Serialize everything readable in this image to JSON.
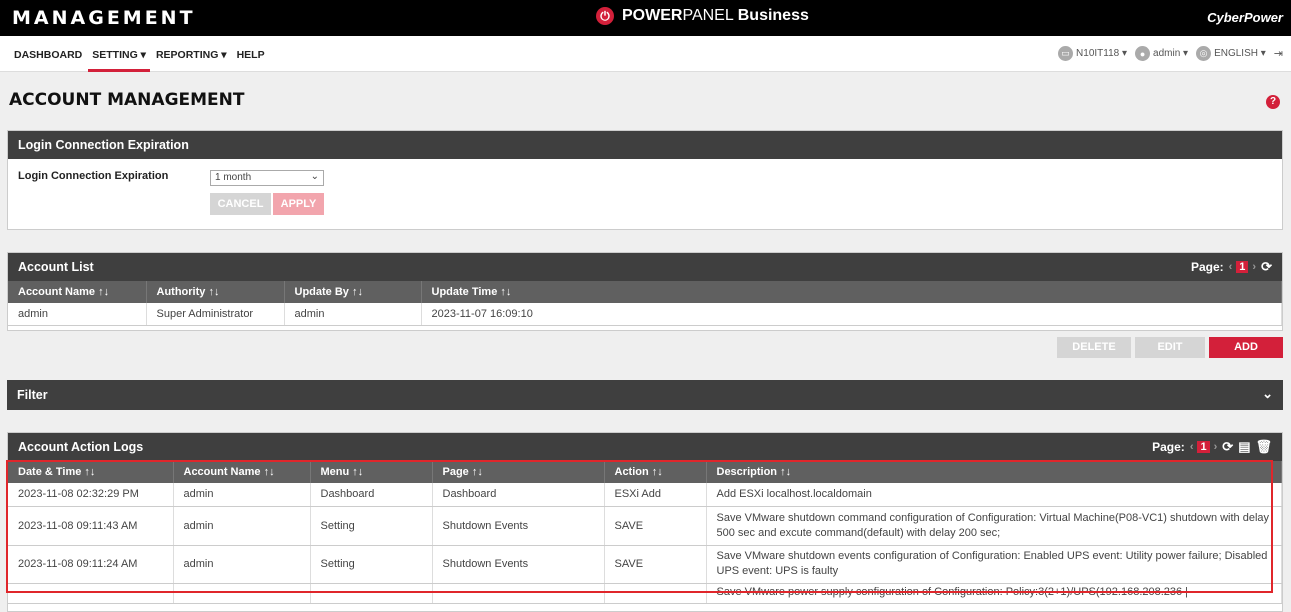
{
  "topbar": {
    "title": "MANAGEMENT",
    "brand_bold": "POWER",
    "brand_light": "PANEL",
    "brand_suffix": "Business",
    "vendor": "CyberPower"
  },
  "nav": {
    "items": [
      {
        "label": "DASHBOARD"
      },
      {
        "label": "SETTING ▾"
      },
      {
        "label": "REPORTING ▾"
      },
      {
        "label": "HELP"
      }
    ],
    "host": "N10IT118 ▾",
    "user": "admin ▾",
    "language": "ENGLISH ▾",
    "logout_icon": "logout-icon"
  },
  "page_title": "ACCOUNT MANAGEMENT",
  "login_panel": {
    "header": "Login Connection Expiration",
    "label": "Login Connection Expiration",
    "selected": "1 month",
    "cancel": "CANCEL",
    "apply": "APPLY"
  },
  "account_list": {
    "header": "Account List",
    "page_label": "Page:",
    "page_num": "1",
    "columns": [
      "Account Name ↑↓",
      "Authority ↑↓",
      "Update By ↑↓",
      "Update Time ↑↓"
    ],
    "rows": [
      [
        "admin",
        "Super Administrator",
        "admin",
        "2023-11-07 16:09:10"
      ]
    ],
    "delete": "DELETE",
    "edit": "EDIT",
    "add": "ADD"
  },
  "filter": {
    "header": "Filter"
  },
  "logs": {
    "header": "Account Action Logs",
    "page_label": "Page:",
    "page_num": "1",
    "columns": [
      "Date & Time ↑↓",
      "Account Name ↑↓",
      "Menu ↑↓",
      "Page ↑↓",
      "Action ↑↓",
      "Description ↑↓"
    ],
    "rows": [
      [
        "2023-11-08 02:32:29 PM",
        "admin",
        "Dashboard",
        "Dashboard",
        "ESXi Add",
        "Add ESXi localhost.localdomain"
      ],
      [
        "2023-11-08 09:11:43 AM",
        "admin",
        "Setting",
        "Shutdown Events",
        "SAVE",
        "Save VMware shutdown command configuration of Configuration: Virtual Machine(P08-VC1) shutdown with delay 500 sec and excute command(default) with delay 200 sec;"
      ],
      [
        "2023-11-08 09:11:24 AM",
        "admin",
        "Setting",
        "Shutdown Events",
        "SAVE",
        "Save VMware shutdown events configuration of Configuration: Enabled UPS event: Utility power failure; Disabled UPS event: UPS is faulty"
      ],
      [
        "",
        "",
        "",
        "",
        "",
        "Save VMware power supply configuration of Configuration: Policy:3(2+1)/UPS(192.168.208.236 |"
      ]
    ]
  },
  "colors": {
    "accent": "#d3203a",
    "header_bg": "#3f3f3f",
    "table_head_bg": "#606060",
    "highlight": "#e0262b"
  }
}
